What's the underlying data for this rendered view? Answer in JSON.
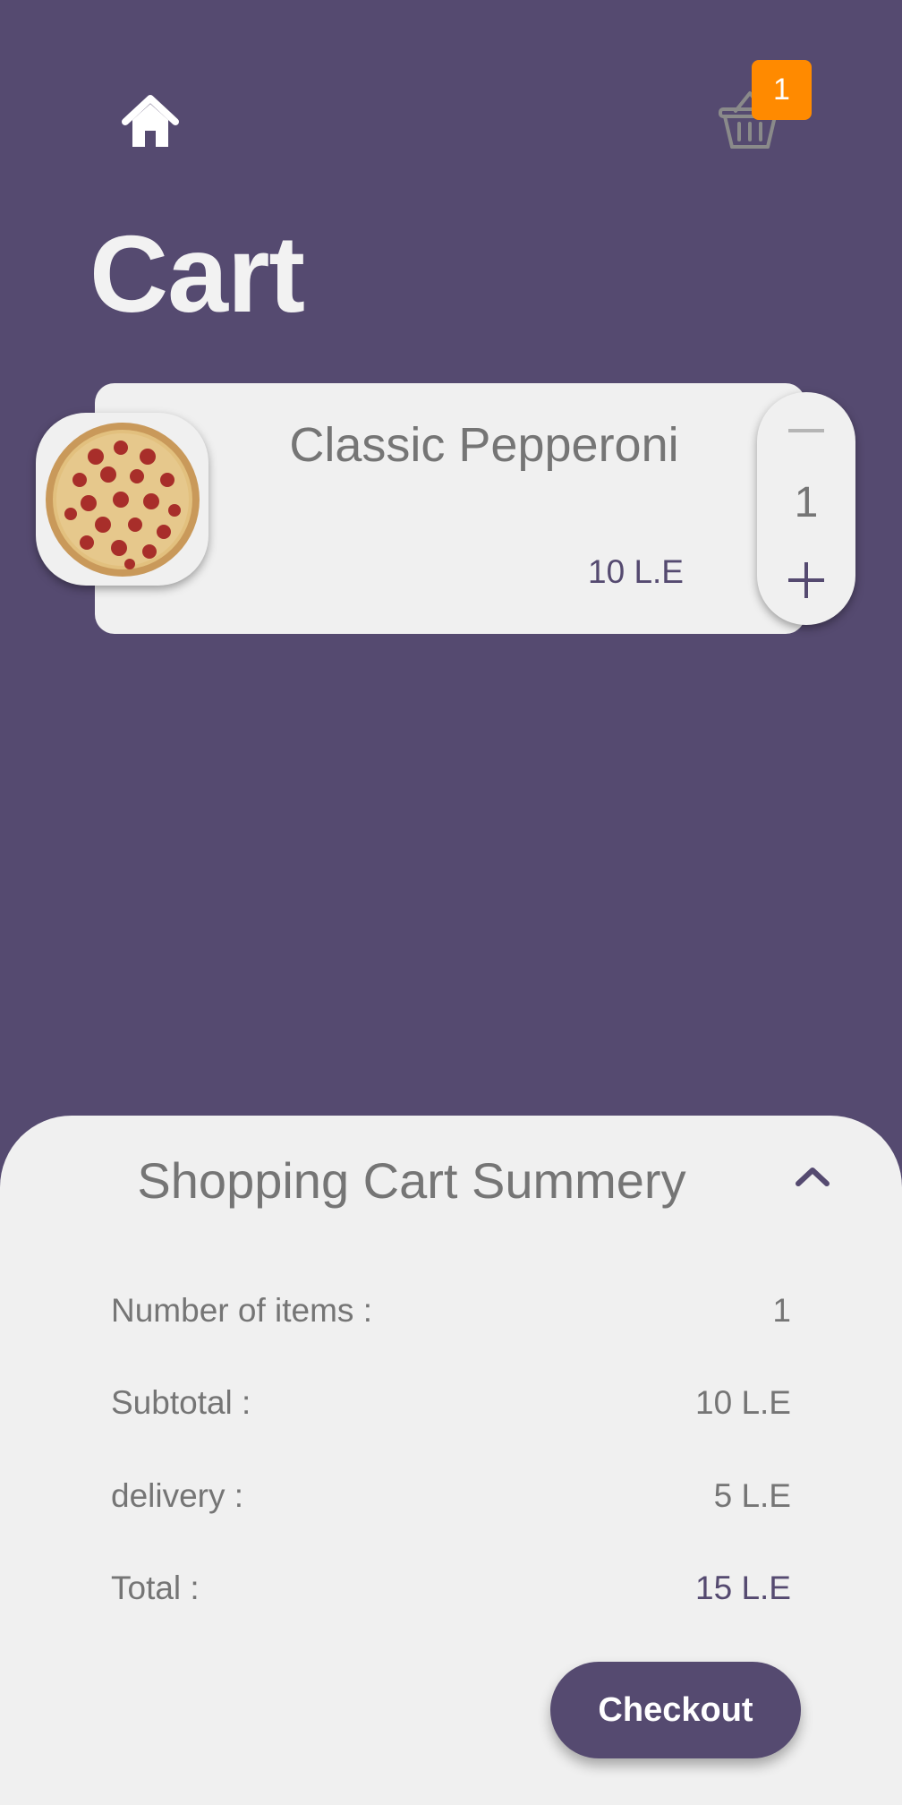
{
  "header": {
    "cart_badge_count": "1"
  },
  "page": {
    "title": "Cart"
  },
  "cart_items": [
    {
      "name": "Classic Pepperoni",
      "price": "10 L.E",
      "quantity": "1"
    }
  ],
  "summary": {
    "title": "Shopping Cart Summery",
    "rows": [
      {
        "label": "Number of items :",
        "value": "1"
      },
      {
        "label": "Subtotal :",
        "value": "10 L.E"
      },
      {
        "label": "delivery :",
        "value": "5 L.E"
      },
      {
        "label": "Total :",
        "value": "15 L.E"
      }
    ],
    "checkout_label": "Checkout"
  },
  "icons": {
    "home": "home-icon",
    "cart": "shopping-basket-icon",
    "minus": "minus-icon",
    "plus": "plus-icon",
    "chevron": "chevron-up-icon"
  },
  "colors": {
    "background": "#554A70",
    "surface": "#F0F0F0",
    "badge": "#FF8A00",
    "text_muted": "#757575",
    "accent": "#554A70"
  }
}
